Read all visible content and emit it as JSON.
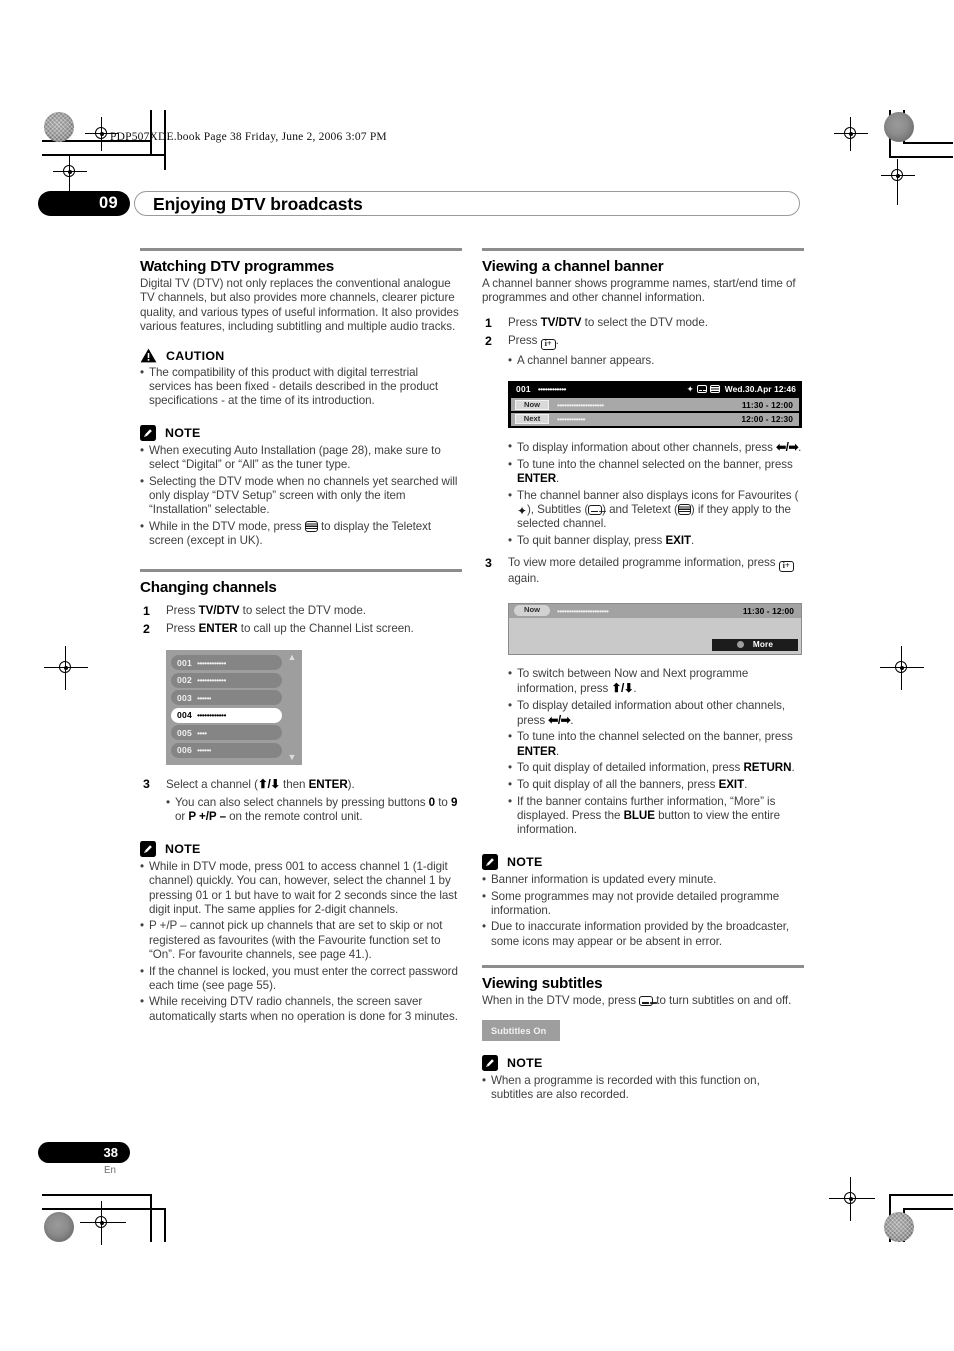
{
  "print_slug": "PDP507XDE.book  Page 38  Friday, June 2, 2006  3:07 PM",
  "chapter": {
    "number": "09",
    "title": "Enjoying DTV broadcasts"
  },
  "footer": {
    "page": "38",
    "lang": "En"
  },
  "left_column": {
    "watching": {
      "heading": "Watching DTV programmes",
      "intro": "Digital TV (DTV) not only replaces the conventional analogue TV channels, but also provides more channels, clearer picture quality, and various types of useful information. It also provides various features, including subtitling and multiple audio tracks.",
      "caution_label": "CAUTION",
      "caution_bullets": [
        "The compatibility of this product with digital terrestrial services has been fixed - details described in the product specifications - at the time of its introduction."
      ],
      "note_label": "NOTE",
      "note_bullets": [
        "When executing Auto Installation (page 28), make sure to select “Digital” or “All” as the tuner type.",
        "Selecting the DTV mode when no channels yet searched will only display “DTV Setup” screen with only the item “Installation” selectable."
      ],
      "note_bullet_teletext_pre": "While in the DTV mode, press ",
      "note_bullet_teletext_post": " to display the Teletext screen (except in UK)."
    },
    "changing": {
      "heading": "Changing channels",
      "step1_num": "1",
      "step1_pre": "Press ",
      "step1_bold": "TV/DTV",
      "step1_post": " to select the DTV mode.",
      "step2_num": "2",
      "step2_pre": "Press ",
      "step2_bold": "ENTER",
      "step2_post": " to call up the Channel List screen.",
      "step3_num": "3",
      "step3_pre": "Select a channel (",
      "step3_arrows": "⬆/⬇",
      "step3_mid": " then ",
      "step3_bold": "ENTER",
      "step3_post": ").",
      "step3_sub_a": "You can also select channels by pressing buttons ",
      "step3_sub_b": "0",
      "step3_sub_c": " to ",
      "step3_sub_d": "9",
      "step3_sub_e": " or ",
      "step3_sub_f": "P +/P –",
      "step3_sub_g": " on the remote control unit.",
      "channel_list": {
        "rows": [
          {
            "num": "001",
            "dots": "••••••••••••",
            "selected": false
          },
          {
            "num": "002",
            "dots": "••••••••••••",
            "selected": false
          },
          {
            "num": "003",
            "dots": "••••••",
            "selected": false
          },
          {
            "num": "004",
            "dots": "••••••••••••",
            "selected": true
          },
          {
            "num": "005",
            "dots": "••••",
            "selected": false
          },
          {
            "num": "006",
            "dots": "••••••",
            "selected": false
          }
        ],
        "scroll_up": "▲",
        "scroll_down": "▼"
      },
      "note_label": "NOTE",
      "note_bullets": [
        "While in DTV mode, press 001 to access channel 1 (1-digit channel) quickly. You can, however, select the channel 1 by pressing 01 or 1 but have to wait for 2 seconds since the last digit input. The same applies for 2-digit channels.",
        "P +/P – cannot pick up channels that are set to skip or not registered as favourites (with the Favourite function set to “On”. For favourite channels, see page 41.).",
        "If the channel is locked, you must enter the correct password each time (see page 55).",
        "While receiving DTV radio channels, the screen saver automatically starts when no operation is done for 3 minutes."
      ]
    }
  },
  "right_column": {
    "banner": {
      "heading": "Viewing a channel banner",
      "intro": "A channel banner shows programme names, start/end time of programmes and other channel information.",
      "step1_num": "1",
      "step1_pre": "Press ",
      "step1_bold": "TV/DTV",
      "step1_post": " to select the DTV mode.",
      "step2_num": "2",
      "step2_pre": "Press ",
      "step2_post": ".",
      "step2_sub": "A channel banner appears.",
      "osd": {
        "channel_num": "001",
        "channel_dots": "••••••••••••",
        "datetime": "Wed.30.Apr 12:46",
        "now_tag": "Now",
        "now_dots": "••••••••••••••••••••",
        "now_time": "11:30 - 12:00",
        "next_tag": "Next",
        "next_dots": "••••••••••••",
        "next_time": "12:00 - 12:30"
      },
      "bullets": {
        "b1_pre": "To display information about other channels, press ",
        "b1_arrows": "⬅/➡",
        "b1_post": ".",
        "b2_pre": "To tune into the channel selected on the banner, press ",
        "b2_bold": "ENTER",
        "b2_post": ".",
        "b3_pre": "The channel banner also displays icons for Favourites (",
        "b3_mid1": "), Subtitles (",
        "b3_mid2": ") and Teletext (",
        "b3_post": ") if they apply to the selected channel.",
        "b4_pre": "To quit banner display, press ",
        "b4_bold": "EXIT",
        "b4_post": "."
      },
      "step3_num": "3",
      "step3_pre": "To view more detailed programme information, press ",
      "step3_post": " again.",
      "detail_osd": {
        "tag": "Now",
        "dots": "••••••••••••••••••••••",
        "time": "11:30 - 12:00",
        "more_label": "More"
      },
      "detail_bullets": {
        "d1_pre": "To switch between Now and Next programme information, press ",
        "d1_arrows": "⬆/⬇",
        "d1_post": ".",
        "d2_pre": "To display detailed information about other channels, press ",
        "d2_arrows": "⬅/➡",
        "d2_post": ".",
        "d3_pre": "To tune into the channel selected on the banner, press ",
        "d3_bold": "ENTER",
        "d3_post": ".",
        "d4_pre": "To quit display of detailed information, press ",
        "d4_bold": "RETURN",
        "d4_post": ".",
        "d5_pre": "To quit display of all the banners, press ",
        "d5_bold": "EXIT",
        "d5_post": ".",
        "d6_pre": "If the banner contains further information, “More” is displayed. Press the ",
        "d6_bold": "BLUE",
        "d6_post": " button to view the entire information."
      },
      "note_label": "NOTE",
      "note_bullets": [
        "Banner information is updated every minute.",
        "Some programmes may not provide detailed programme information.",
        "Due to inaccurate information provided by the broadcaster, some icons may appear or be absent in error."
      ]
    },
    "subtitles": {
      "heading": "Viewing subtitles",
      "intro_pre": "When in the DTV mode, press ",
      "intro_post": " to turn subtitles on and off.",
      "chip_label": "Subtitles On",
      "note_label": "NOTE",
      "note_bullets": [
        "When a programme is recorded with this function on, subtitles are also recorded."
      ]
    }
  }
}
